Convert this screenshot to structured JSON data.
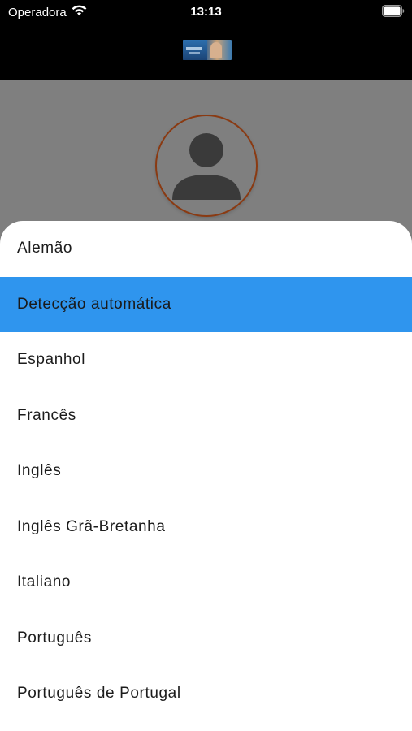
{
  "status_bar": {
    "carrier": "Operadora",
    "time": "13:13",
    "wifi_icon": "wifi-icon",
    "battery_icon": "battery-icon"
  },
  "header": {
    "logo_icon": "app-logo"
  },
  "profile": {
    "avatar_icon": "person-avatar-icon",
    "avatar_border_color": "#8a3a12"
  },
  "language_sheet": {
    "selected_index": 1,
    "selected_color": "#2f95ee",
    "items": [
      {
        "label": "Alemão"
      },
      {
        "label": "Detecção automática"
      },
      {
        "label": "Espanhol"
      },
      {
        "label": "Francês"
      },
      {
        "label": "Inglês"
      },
      {
        "label": "Inglês Grã-Bretanha"
      },
      {
        "label": "Italiano"
      },
      {
        "label": "Português"
      },
      {
        "label": "Português de Portugal"
      }
    ]
  }
}
